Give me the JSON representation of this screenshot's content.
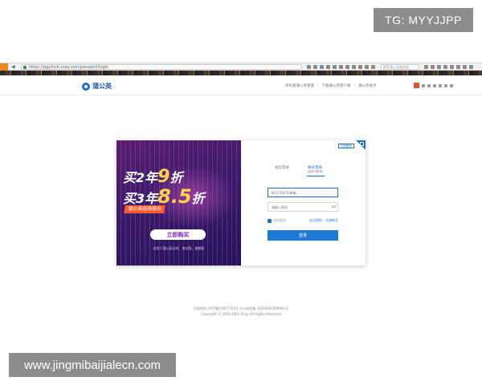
{
  "overlay": {
    "tg_badge": "TG: MYYJJPP",
    "watermark": "www.jingmibaijialecn.com"
  },
  "browser": {
    "url": "https://pgyfuck.oray.com/passport/login",
    "search_placeholder": "搜索蒲公英路由器"
  },
  "header": {
    "logo_text": "蒲公英",
    "links": [
      "手机版蒲公英管理",
      "下载蒲公英客户端",
      "蒲公英助手"
    ]
  },
  "promo": {
    "line1_prefix": "买2年",
    "line1_discount": "9",
    "line1_suffix": "折",
    "line2_prefix": "买3年",
    "line2_discount": "8.5",
    "line2_suffix": "折",
    "tag": "蒲公英组网服务",
    "buy_button": "立即购买",
    "note": "适用于蒲公英全线、商业版、旗舰版"
  },
  "login": {
    "corner_tag": "扫码登录",
    "tab_sms": "短信登录",
    "tab_account": "帐号登录",
    "tab_account_sub": "(支持子帐号)",
    "account_placeholder": "帐号/手机号/邮箱",
    "password_placeholder": "请输入密码",
    "remember_label": "自动登录",
    "forgot_link": "忘记密码",
    "register_link": "注册帐号",
    "login_button": "登录"
  },
  "footer": {
    "line1": "贝锐科技 沪ICP备10007354号 沪公网安备 31010402000061号",
    "line2": "Copyright © 2000-2021 Oray. All Rights Reserved"
  },
  "colors": {
    "brand_blue": "#1d6fc7",
    "promo_yellow": "#ffd24a",
    "promo_tag": "#ff5a2e"
  }
}
